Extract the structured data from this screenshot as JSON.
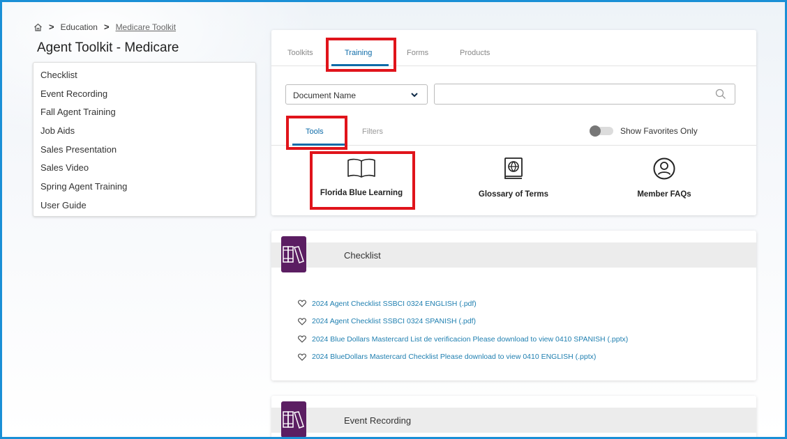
{
  "breadcrumb": {
    "home_icon": "home-icon",
    "separator": ">",
    "items": [
      "Education",
      "Medicare Toolkit"
    ]
  },
  "page_title": "Agent Toolkit - Medicare",
  "sidebar": {
    "items": [
      {
        "label": "Checklist"
      },
      {
        "label": "Event Recording"
      },
      {
        "label": "Fall Agent Training"
      },
      {
        "label": "Job Aids"
      },
      {
        "label": "Sales Presentation"
      },
      {
        "label": "Sales Video"
      },
      {
        "label": "Spring Agent Training"
      },
      {
        "label": "User Guide"
      }
    ]
  },
  "main_tabs": {
    "items": [
      {
        "label": "Toolkits"
      },
      {
        "label": "Training",
        "active": true
      },
      {
        "label": "Forms"
      },
      {
        "label": "Products"
      }
    ]
  },
  "search": {
    "dropdown_value": "Document Name",
    "input_value": "",
    "search_icon": "search-icon"
  },
  "sub_tabs": {
    "items": [
      {
        "label": "Tools",
        "active": true
      },
      {
        "label": "Filters"
      }
    ]
  },
  "favorites_toggle": {
    "label": "Show Favorites Only",
    "on": false
  },
  "tools": [
    {
      "label": "Florida Blue Learning",
      "icon": "open-book-icon"
    },
    {
      "label": "Glossary of Terms",
      "icon": "globe-book-icon"
    },
    {
      "label": "Member FAQs",
      "icon": "user-circle-icon"
    }
  ],
  "sections": {
    "checklist": {
      "title": "Checklist",
      "icon": "books-icon",
      "documents": [
        {
          "label": "2024 Agent Checklist SSBCI 0324 ENGLISH (.pdf)"
        },
        {
          "label": "2024 Agent Checklist SSBCI 0324 SPANISH (.pdf)"
        },
        {
          "label": "2024 Blue Dollars Mastercard List de verificacion Please download to view 0410 SPANISH (.pptx)"
        },
        {
          "label": "2024 BlueDollars Mastercard Checklist Please download to view 0410 ENGLISH (.pptx)"
        }
      ]
    },
    "event_recording": {
      "title": "Event Recording",
      "icon": "books-icon"
    }
  },
  "colors": {
    "frame_border": "#1a8fd6",
    "accent": "#0e6ba8",
    "highlight": "#e0141b",
    "section_icon_bg": "#5b1e62",
    "link": "#1f7fb0"
  }
}
